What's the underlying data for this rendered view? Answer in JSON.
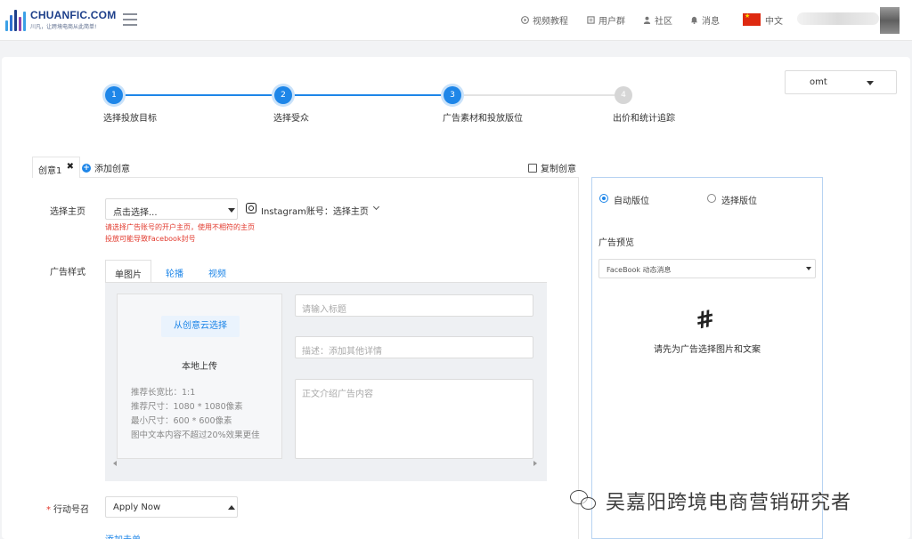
{
  "header": {
    "brand": "CHUANFIC.COM",
    "slogan": "川凡，让跨境电商从此简单!",
    "nav": [
      {
        "label": "视频教程",
        "icon": "play-circle-icon"
      },
      {
        "label": "用户群",
        "icon": "group-icon"
      },
      {
        "label": "社区",
        "icon": "user-icon"
      },
      {
        "label": "消息",
        "icon": "bell-icon"
      }
    ],
    "language": "中文",
    "colors": {
      "brand": "#1d3f8a",
      "accent": "#1e86e8"
    }
  },
  "account_select": {
    "value": "omt"
  },
  "stepper": {
    "current": 3,
    "steps": [
      {
        "num": "1",
        "label": "选择投放目标",
        "state": "done"
      },
      {
        "num": "2",
        "label": "选择受众",
        "state": "done"
      },
      {
        "num": "3",
        "label": "广告素材和投放版位",
        "state": "active"
      },
      {
        "num": "4",
        "label": "出价和统计追踪",
        "state": "todo"
      }
    ]
  },
  "creative_tabs": {
    "tab1": "创意1",
    "add": "添加创意",
    "copy": "复制创意"
  },
  "form": {
    "page_label": "选择主页",
    "page_select": "点击选择...",
    "instagram_label": "Instagram账号：选择主页",
    "warning_line1": "请选择广告账号的开户主页，使用不相符的主页",
    "warning_line2": "投放可能导致Facebook封号",
    "style_label": "广告样式",
    "format_tabs": [
      "单图片",
      "轮播",
      "视频"
    ],
    "cloud_button": "从创意云选择",
    "local_upload": "本地上传",
    "specs": [
      "推荐长宽比：1:1",
      "推荐尺寸：1080 * 1080像素",
      "最小尺寸：600 * 600像素",
      "图中文本内容不超过20%效果更佳"
    ],
    "title_placeholder": "请输入标题",
    "desc_placeholder": "描述：添加其他详情",
    "body_placeholder": "正文介绍广告内容",
    "cta_label": "行动号召",
    "cta_required": "*",
    "cta_value": "Apply Now",
    "add_link": "添加击单"
  },
  "placement": {
    "auto": "自动版位",
    "manual": "选择版位",
    "selected": "auto",
    "preview_title": "广告预览",
    "preview_select": "FaceBook 动态消息",
    "empty_text": "请先为广告选择图片和文案"
  },
  "watermark": {
    "text": "吴嘉阳跨境电商营销研究者"
  }
}
